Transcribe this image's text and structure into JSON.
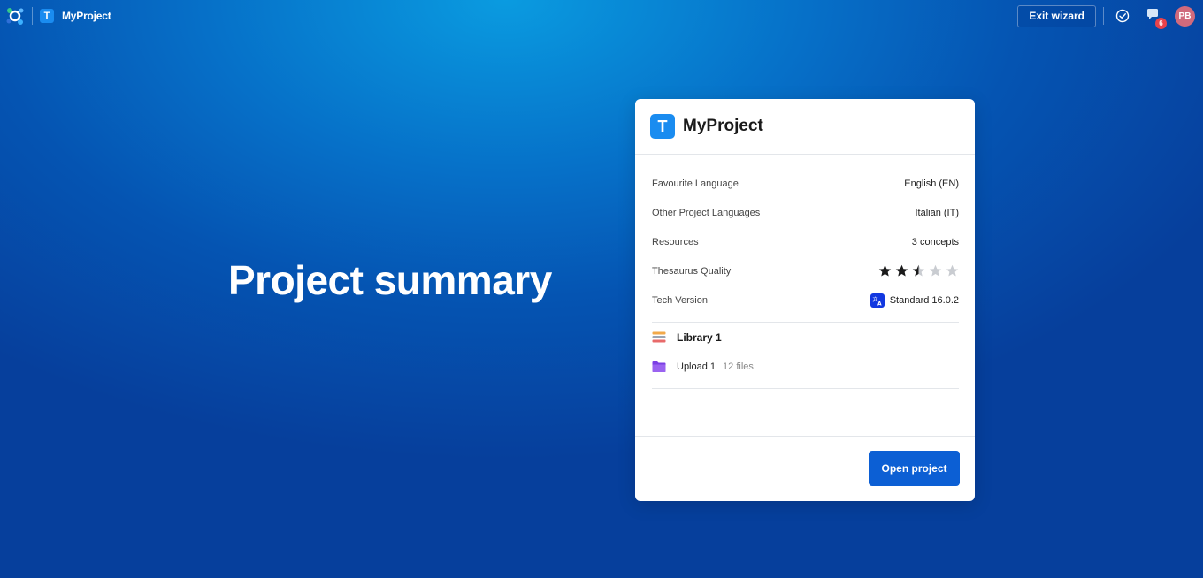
{
  "topbar": {
    "project_badge": "T",
    "project_name": "MyProject",
    "exit_label": "Exit wizard",
    "notification_count": "6",
    "user_initials": "PB"
  },
  "hero": {
    "title": "Project summary"
  },
  "card": {
    "badge": "T",
    "title": "MyProject",
    "rows": [
      {
        "label": "Favourite Language",
        "value": "English (EN)"
      },
      {
        "label": "Other Project Languages",
        "value": "Italian (IT)"
      },
      {
        "label": "Resources",
        "value": "3 concepts"
      },
      {
        "label": "Thesaurus Quality",
        "rating": 2.5,
        "max": 5
      },
      {
        "label": "Tech Version",
        "value": "Standard 16.0.2"
      }
    ],
    "resources": [
      {
        "name": "Library 1",
        "icon": "library-icon"
      },
      {
        "name": "Upload 1",
        "count": "12 files",
        "icon": "folder-icon"
      }
    ],
    "open_label": "Open project"
  },
  "colors": {
    "accent": "#0c5fd4",
    "badge_blue": "#1a8cf0",
    "notification_red": "#e8424a",
    "avatar": "#d06a7c"
  }
}
